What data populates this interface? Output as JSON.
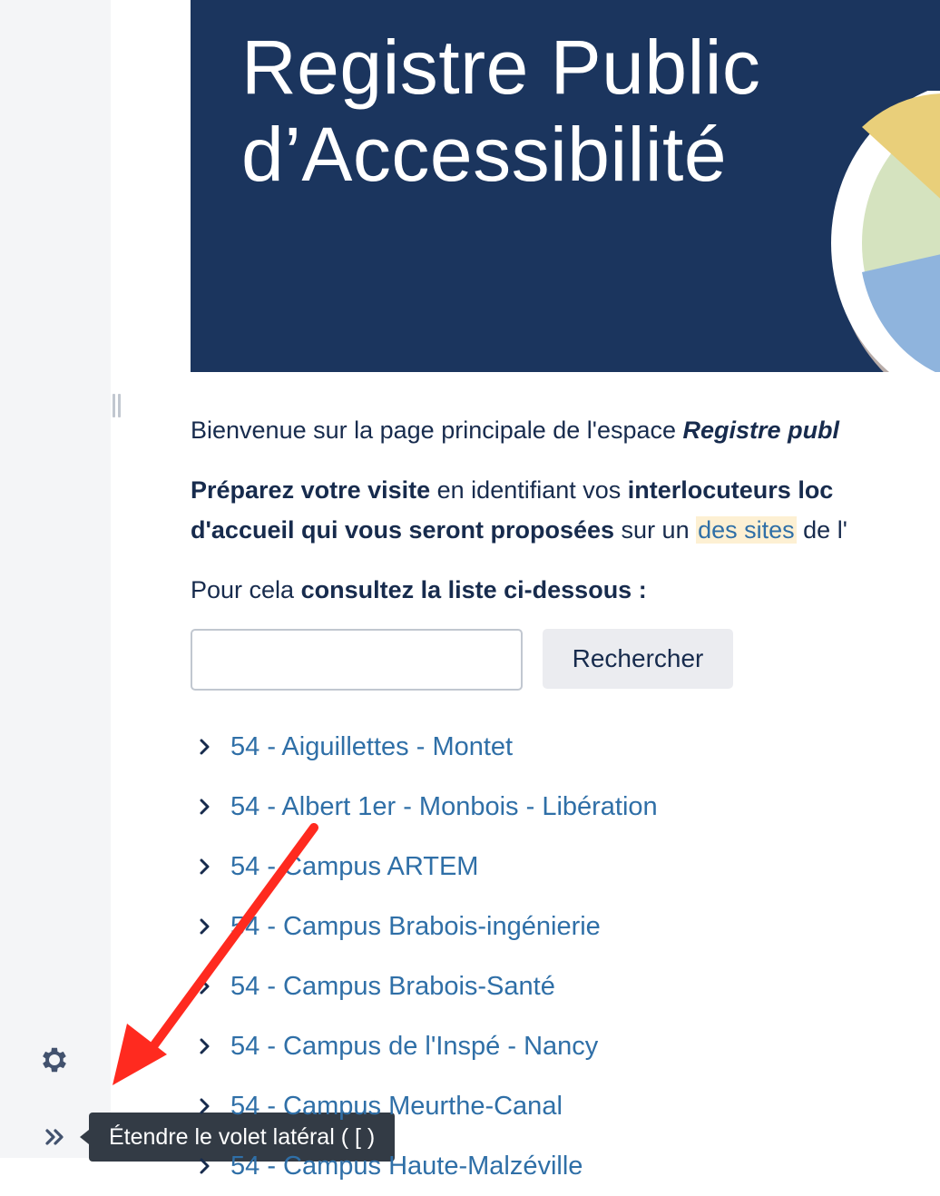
{
  "sidebar": {
    "settings_icon": "gear-icon",
    "expand_icon": "double-chevron-right-icon",
    "tooltip": "Étendre le volet latéral ( [ )"
  },
  "banner": {
    "title_line1": "Registre Public",
    "title_line2": "d’Accessibilité",
    "background": "#1b355e"
  },
  "intro": {
    "p1_text": "Bienvenue sur la page principale de l'espace ",
    "p1_emph": "Registre publ",
    "p2_bold1": "Préparez votre visite",
    "p2_text1": " en identifiant vos ",
    "p2_bold2": "interlocuteurs loc",
    "p2_bold3": "d'accueil qui vous seront proposées",
    "p2_text2": " sur un ",
    "p2_link": "des sites",
    "p2_text3": " de l'",
    "p3_text": "Pour cela ",
    "p3_bold": "consultez la liste ci-dessous :"
  },
  "search": {
    "input_value": "",
    "button_label": "Rechercher"
  },
  "tree_items": [
    "54 - Aiguillettes - Montet",
    "54 - Albert 1er - Monbois - Libération",
    "54 - Campus ARTEM",
    "54 - Campus Brabois-ingénierie",
    "54 - Campus Brabois-Santé",
    "54 - Campus de l'Inspé - Nancy",
    "54 - Campus Meurthe-Canal",
    "54 - Campus Haute-Malzéville"
  ],
  "colors": {
    "link": "#2f6fa7",
    "text": "#172b4d",
    "annotation_arrow": "#ff2a1f"
  }
}
